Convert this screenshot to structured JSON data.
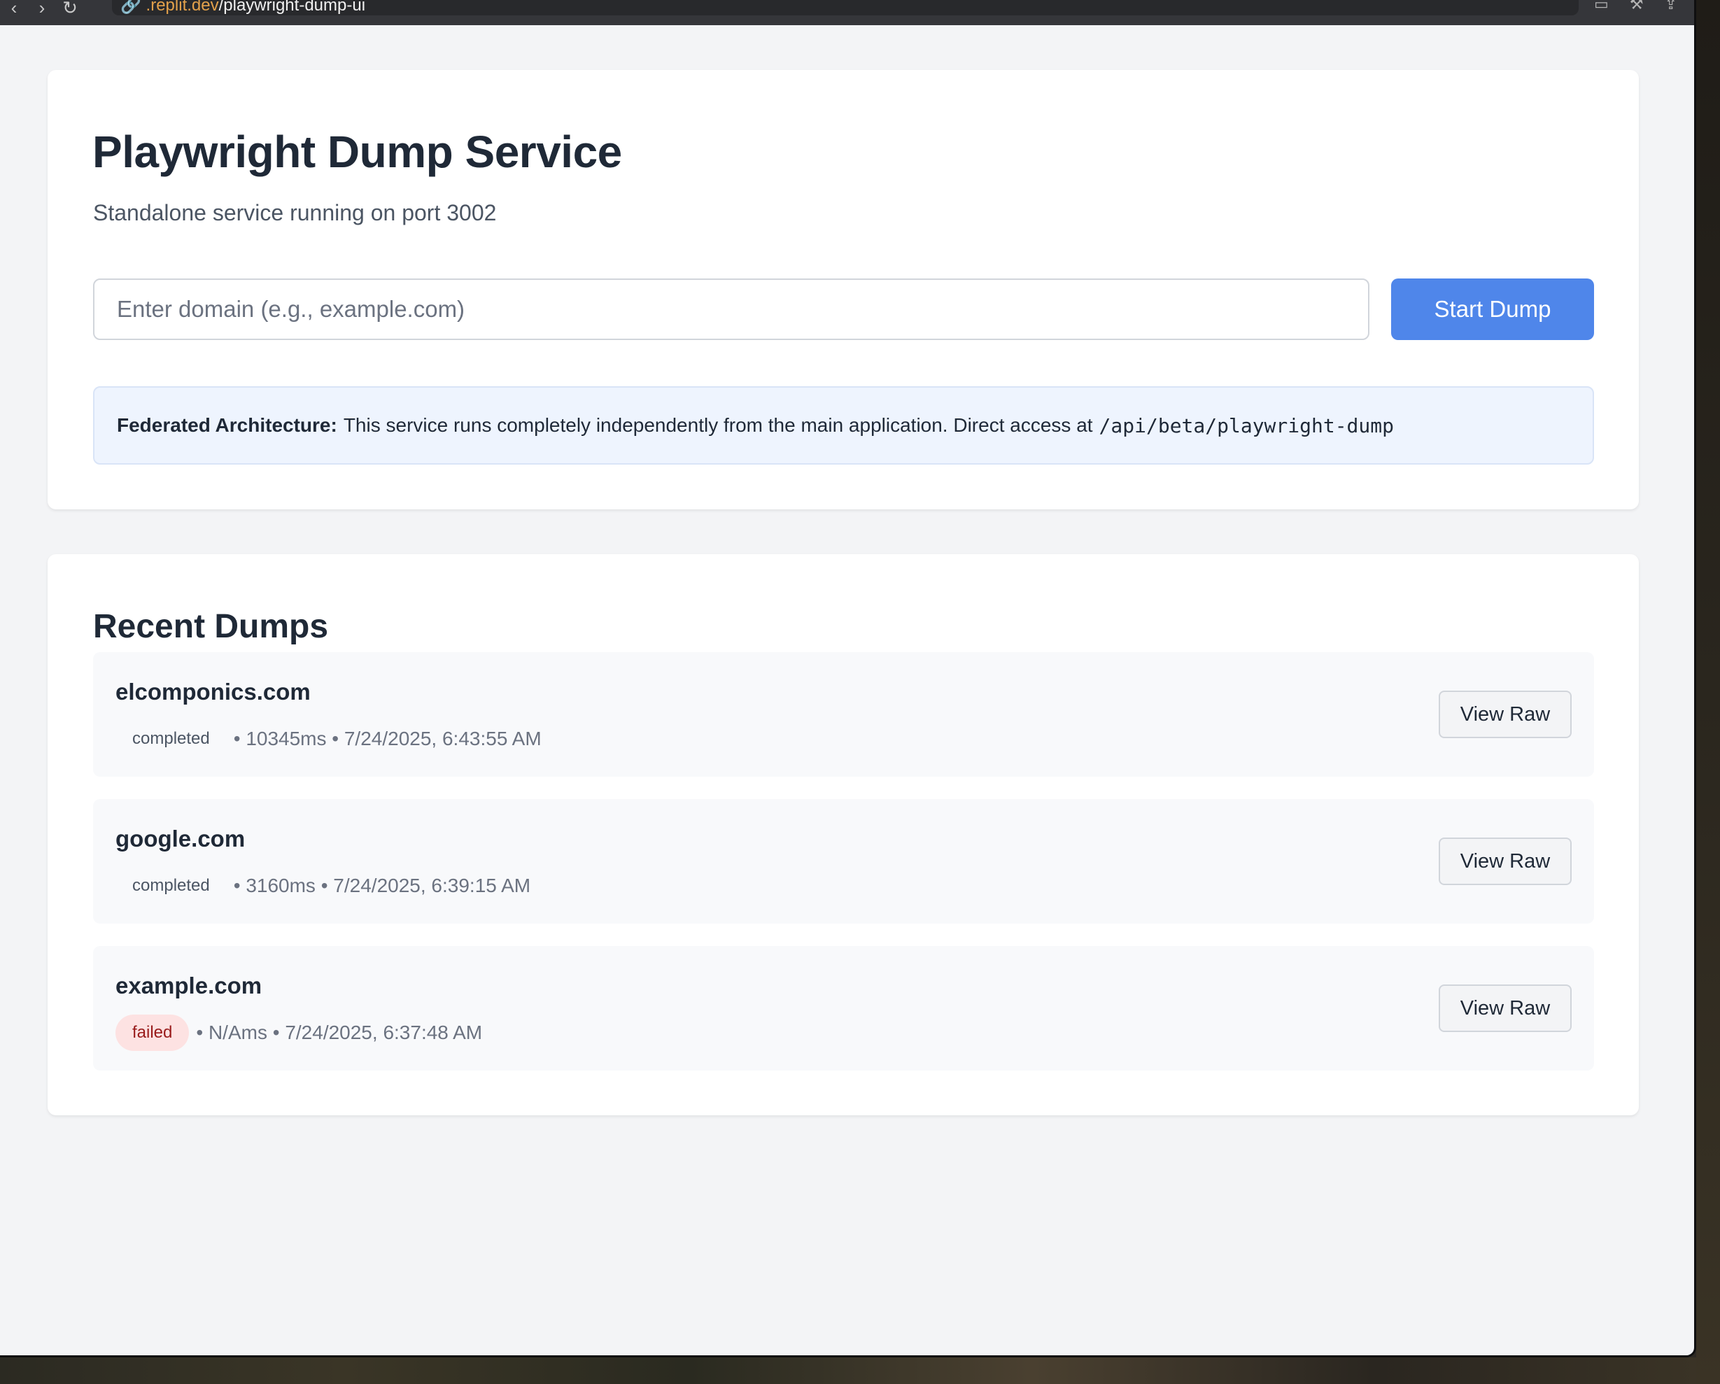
{
  "browser": {
    "url_host": "🔗 .replit.dev",
    "url_path": "/playwright-dump-ui"
  },
  "header": {
    "title": "Playwright Dump Service",
    "subtitle": "Standalone service running on port 3002"
  },
  "form": {
    "placeholder": "Enter domain (e.g., example.com)",
    "value": "",
    "submit_label": "Start Dump"
  },
  "info": {
    "label": "Federated Architecture:",
    "text": "This service runs completely independently from the main application. Direct access at",
    "code": "/api/beta/playwright-dump"
  },
  "recent": {
    "title": "Recent Dumps",
    "button_label": "View Raw",
    "items": [
      {
        "domain": "elcomponics.com",
        "status": "completed",
        "meta": "• 10345ms • 7/24/2025, 6:43:55 AM"
      },
      {
        "domain": "google.com",
        "status": "completed",
        "meta": "• 3160ms • 7/24/2025, 6:39:15 AM"
      },
      {
        "domain": "example.com",
        "status": "failed",
        "meta": "• N/Ams • 7/24/2025, 6:37:48 AM"
      }
    ]
  },
  "colors": {
    "accent": "#4f86ea",
    "failed_bg": "#fde2e2",
    "failed_text": "#991b1b"
  }
}
